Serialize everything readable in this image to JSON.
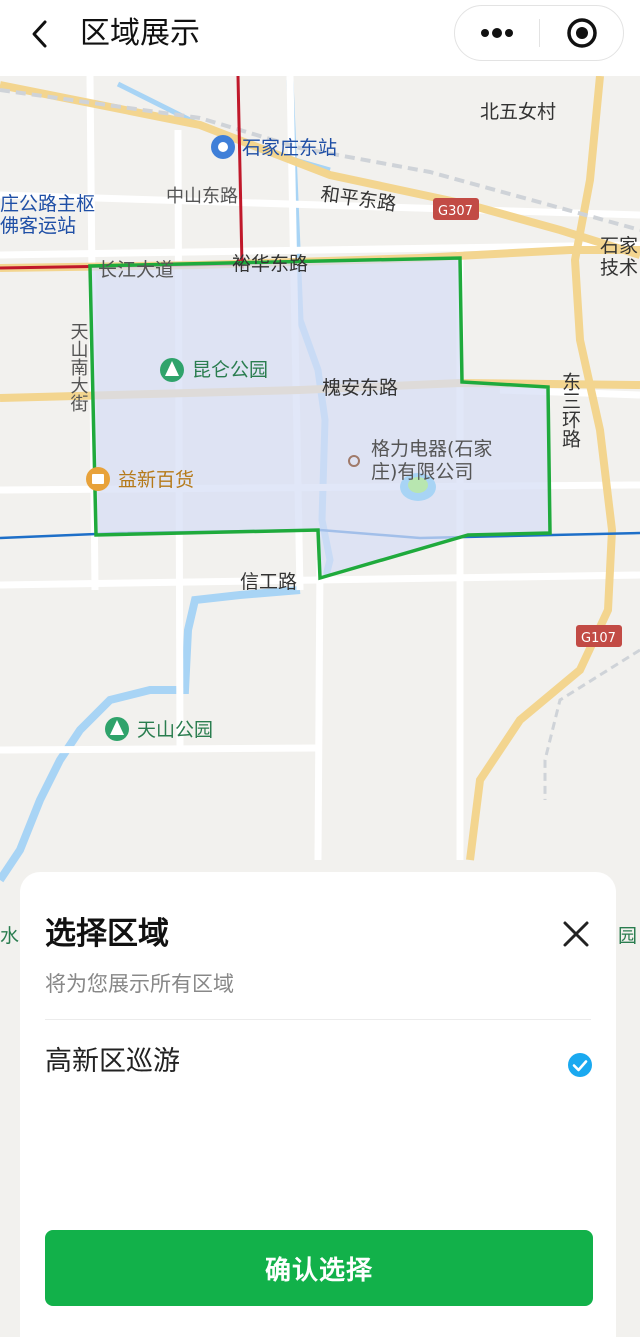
{
  "header": {
    "title": "区域展示"
  },
  "map": {
    "labels": {
      "north_five_village": "北五女村",
      "station": "石家庄东站",
      "zhongshan_rd": "中山东路",
      "heping_rd": "和平东路",
      "g307": "G307",
      "hub_line1": "庄公路主枢",
      "hub_line2": "佛客运站",
      "changjiang": "长江大道",
      "yuhua_rd": "裕华东路",
      "shijia_tech_1": "石家",
      "shijia_tech_2": "技术",
      "tianshan_s": "天山南大街",
      "kunlun_park": "昆仑公园",
      "huaian_rd": "槐安东路",
      "ring3_east": "东三环路",
      "gree_line1": "格力电器(石家",
      "gree_line2": "庄)有限公司",
      "yixin_mall": "益新百货",
      "xingong_rd": "信工路",
      "g107": "G107",
      "tianshan_park": "天山公园",
      "edge_left": "水公",
      "edge_right": "园"
    }
  },
  "sheet": {
    "title": "选择区域",
    "subtitle": "将为您展示所有区域",
    "option_label": "高新区巡游",
    "option_selected": true,
    "confirm_label": "确认选择"
  },
  "colors": {
    "accent_green": "#12b14a",
    "check_blue": "#1aa9f0",
    "region_outline": "#1faa3c"
  }
}
